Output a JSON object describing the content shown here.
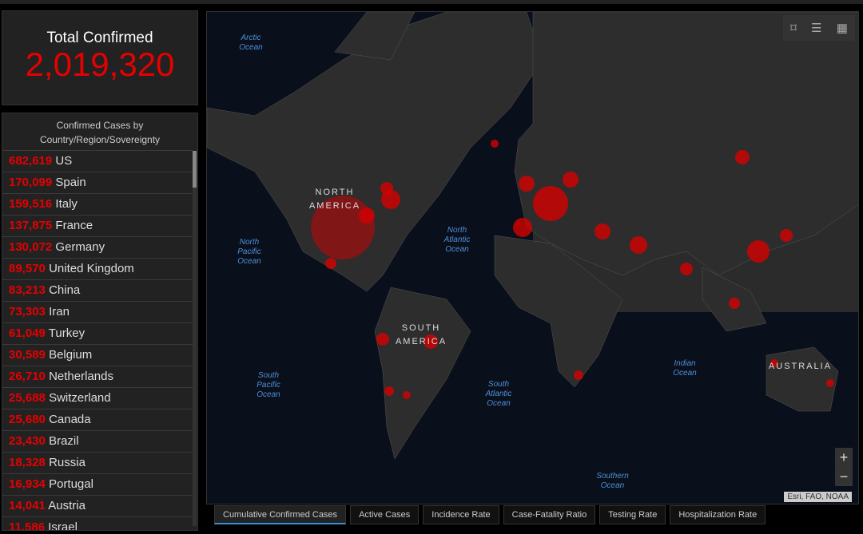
{
  "total": {
    "title": "Total Confirmed",
    "value": "2,019,320"
  },
  "list": {
    "title": "Confirmed Cases by Country/Region/Sovereignty",
    "items": [
      {
        "n": "682,619",
        "c": "US"
      },
      {
        "n": "170,099",
        "c": "Spain"
      },
      {
        "n": "159,516",
        "c": "Italy"
      },
      {
        "n": "137,875",
        "c": "France"
      },
      {
        "n": "130,072",
        "c": "Germany"
      },
      {
        "n": "89,570",
        "c": "United Kingdom"
      },
      {
        "n": "83,213",
        "c": "China"
      },
      {
        "n": "73,303",
        "c": "Iran"
      },
      {
        "n": "61,049",
        "c": "Turkey"
      },
      {
        "n": "30,589",
        "c": "Belgium"
      },
      {
        "n": "26,710",
        "c": "Netherlands"
      },
      {
        "n": "25,688",
        "c": "Switzerland"
      },
      {
        "n": "25,680",
        "c": "Canada"
      },
      {
        "n": "23,430",
        "c": "Brazil"
      },
      {
        "n": "18,328",
        "c": "Russia"
      },
      {
        "n": "16,934",
        "c": "Portugal"
      },
      {
        "n": "14,041",
        "c": "Austria"
      },
      {
        "n": "11,586",
        "c": "Israel"
      }
    ]
  },
  "map": {
    "oceans": [
      "Arctic Ocean",
      "North Pacific Ocean",
      "North Atlantic Ocean",
      "South Pacific Ocean",
      "South Atlantic Ocean",
      "Indian Ocean",
      "Southern Ocean"
    ],
    "continents": [
      "NORTH AMERICA",
      "SOUTH AMERICA",
      "AUSTRALIA"
    ],
    "attribution": "Esri, FAO, NOAA",
    "zoom_in": "+",
    "zoom_out": "−"
  },
  "tabs": [
    "Cumulative Confirmed Cases",
    "Active Cases",
    "Incidence Rate",
    "Case-Fatality Ratio",
    "Testing Rate",
    "Hospitalization Rate"
  ]
}
